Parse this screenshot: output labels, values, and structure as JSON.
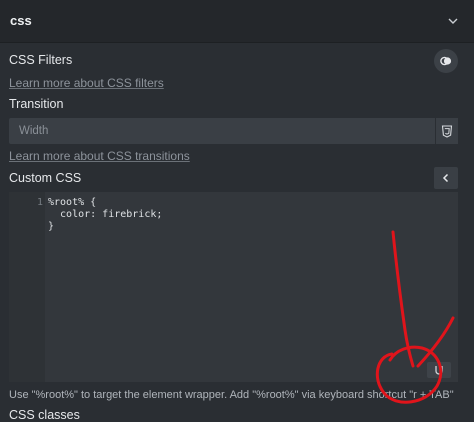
{
  "section": {
    "title": "css"
  },
  "css_filters": {
    "label": "CSS Filters",
    "learn_link": "Learn more about CSS filters"
  },
  "transition": {
    "label": "Transition",
    "width_placeholder": "Width",
    "learn_link": "Learn more about CSS transitions"
  },
  "custom_css": {
    "label": "Custom CSS",
    "line_numbers": [
      "1"
    ],
    "code_lines": [
      "%root% {",
      "  color: firebrick;",
      "}"
    ]
  },
  "hint": "Use \"%root%\" to target the element wrapper. Add \"%root%\" via keyboard shortcut \"r + TAB\"",
  "css_classes": {
    "label": "CSS classes"
  },
  "icons": {
    "collapse": "chevron-down-icon",
    "filters": "filter-icon",
    "units": "css-units-icon",
    "editor_toggle": "chevron-left-icon",
    "resize": "resize-handle-icon"
  },
  "colors": {
    "annotation": "#e0141b",
    "panel": "#2a2e33"
  }
}
